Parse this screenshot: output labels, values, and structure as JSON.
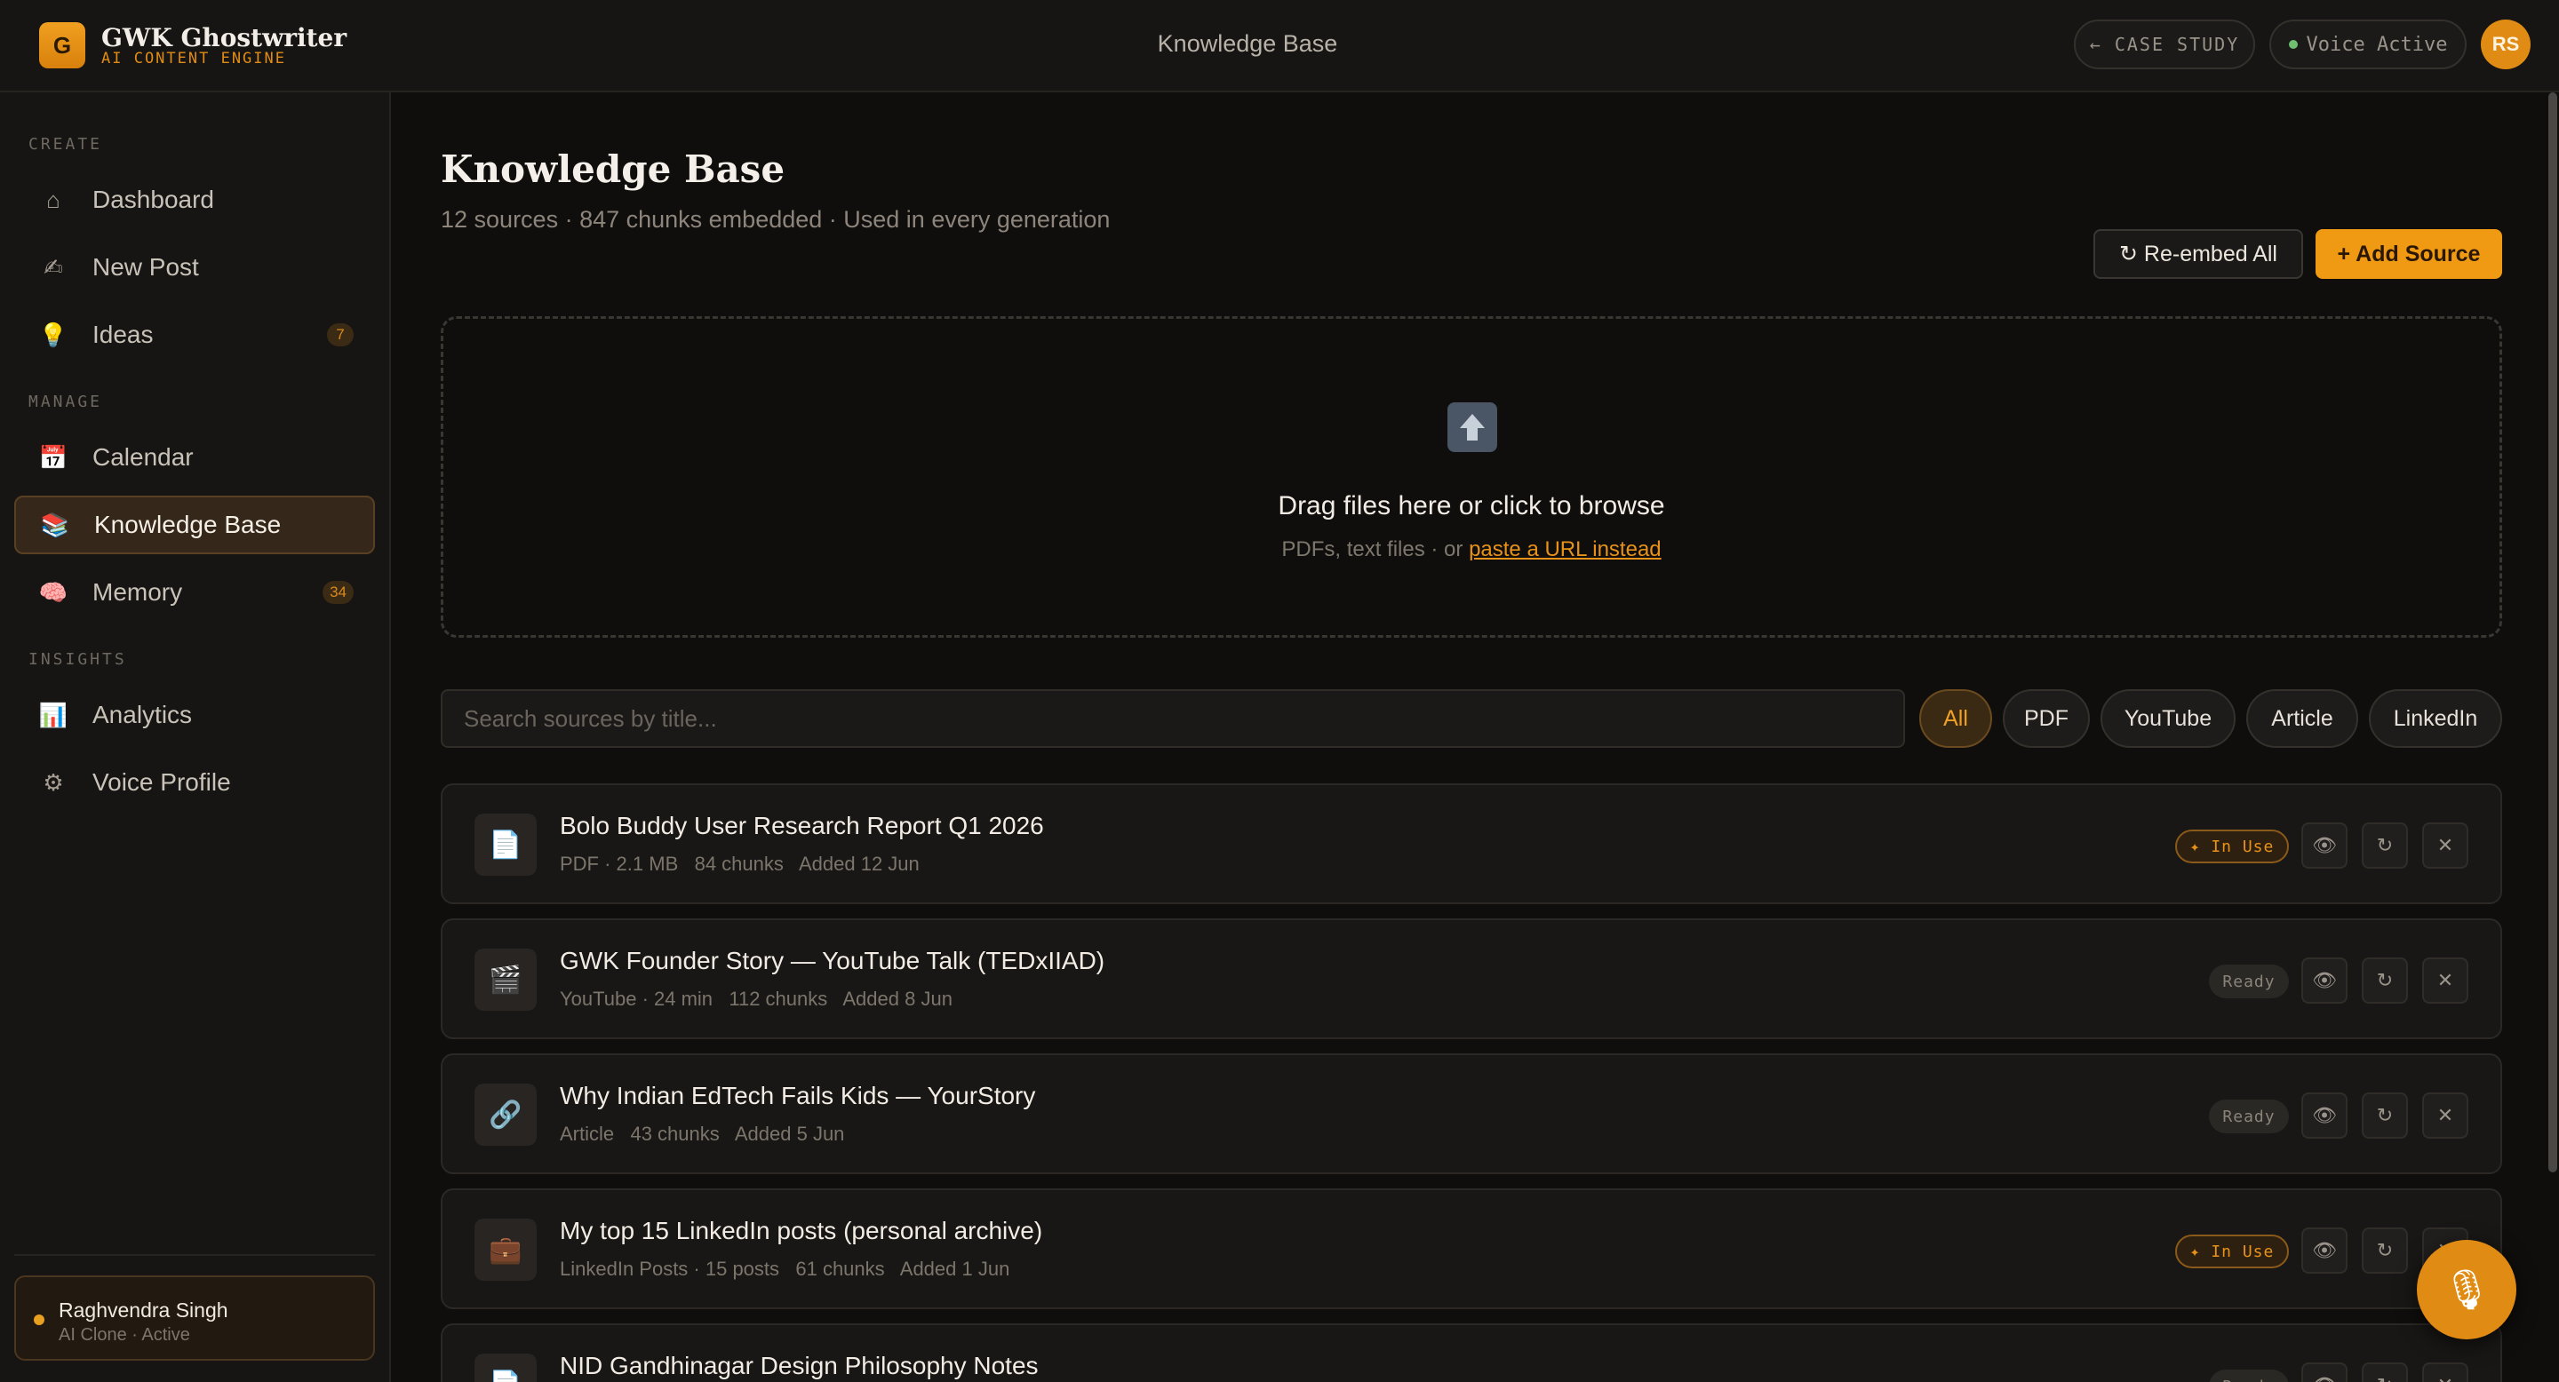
{
  "brand": {
    "logo_letter": "G",
    "name": "GWK Ghostwriter",
    "tagline": "AI CONTENT ENGINE"
  },
  "header": {
    "title": "Knowledge Base",
    "case_study_label": "← CASE STUDY",
    "voice_status": "Voice Active",
    "avatar_initials": "RS"
  },
  "sidebar": {
    "sections": {
      "create": "CREATE",
      "manage": "MANAGE",
      "insights": "INSIGHTS"
    },
    "items": [
      {
        "label": "Dashboard",
        "icon": "⌂",
        "icon_name": "home-icon"
      },
      {
        "label": "New Post",
        "icon": "✍",
        "icon_name": "writing-hand-icon"
      },
      {
        "label": "Ideas",
        "icon": "💡",
        "icon_name": "lightbulb-icon",
        "badge": "7"
      },
      {
        "label": "Calendar",
        "icon": "📅",
        "icon_name": "calendar-icon"
      },
      {
        "label": "Knowledge Base",
        "icon": "📚",
        "icon_name": "books-icon",
        "active": true
      },
      {
        "label": "Memory",
        "icon": "🧠",
        "icon_name": "brain-icon",
        "badge": "34"
      },
      {
        "label": "Analytics",
        "icon": "📊",
        "icon_name": "chart-icon"
      },
      {
        "label": "Voice Profile",
        "icon": "⚙",
        "icon_name": "gear-icon"
      }
    ],
    "user": {
      "name": "Raghvendra Singh",
      "status": "AI Clone · Active"
    }
  },
  "main": {
    "title": "Knowledge Base",
    "subtitle": "12 sources · 847 chunks embedded · Used in every generation",
    "reembed_label": "↻ Re-embed All",
    "add_label": "+ Add Source",
    "dropzone": {
      "title": "Drag files here or click to browse",
      "hint": "PDFs, text files · or ",
      "link": "paste a URL instead"
    },
    "search_placeholder": "Search sources by title...",
    "filters": [
      "All",
      "PDF",
      "YouTube",
      "Article",
      "LinkedIn"
    ],
    "active_filter": "All",
    "sources": [
      {
        "icon": "📄",
        "icon_name": "document-icon",
        "title": "Bolo Buddy User Research Report Q1 2026",
        "meta": "PDF · 2.1 MB   84 chunks   Added 12 Jun",
        "status": "✦ In Use",
        "status_type": "inuse"
      },
      {
        "icon": "🎬",
        "icon_name": "clapper-icon",
        "title": "GWK Founder Story — YouTube Talk (TEDxIIAD)",
        "meta": "YouTube · 24 min   112 chunks   Added 8 Jun",
        "status": "Ready",
        "status_type": "ready"
      },
      {
        "icon": "🔗",
        "icon_name": "link-icon",
        "title": "Why Indian EdTech Fails Kids — YourStory",
        "meta": "Article   43 chunks   Added 5 Jun",
        "status": "Ready",
        "status_type": "ready"
      },
      {
        "icon": "💼",
        "icon_name": "briefcase-icon",
        "title": "My top 15 LinkedIn posts (personal archive)",
        "meta": "LinkedIn Posts · 15 posts   61 chunks   Added 1 Jun",
        "status": "✦ In Use",
        "status_type": "inuse"
      },
      {
        "icon": "📄",
        "icon_name": "document-icon",
        "title": "NID Gandhinagar Design Philosophy Notes",
        "meta": "",
        "status": "Ready",
        "status_type": "ready"
      }
    ],
    "actions": {
      "view": "👁",
      "refresh": "↻",
      "delete": "✕"
    }
  },
  "fab": {
    "icon": "🎙",
    "icon_name": "microphone-icon"
  }
}
